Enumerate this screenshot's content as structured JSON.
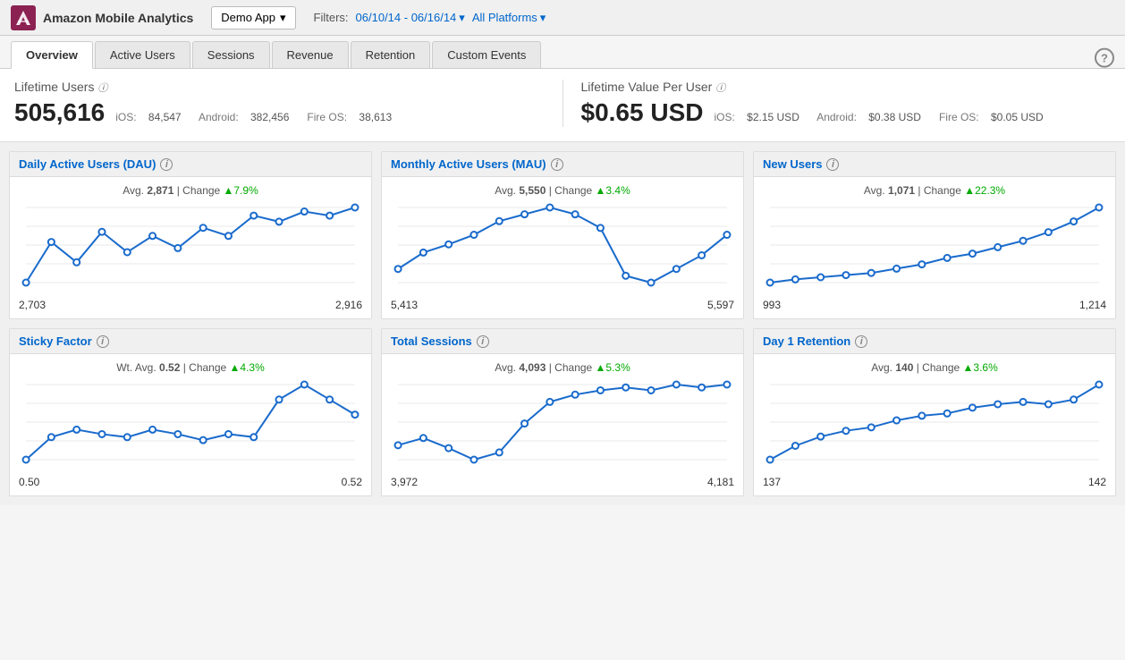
{
  "app": {
    "logo_text": "Amazon Mobile Analytics",
    "demo_app": "Demo App",
    "filters_label": "Filters:",
    "date_range": "06/10/14 - 06/16/14",
    "platforms": "All Platforms",
    "help_char": "?"
  },
  "tabs": [
    {
      "id": "overview",
      "label": "Overview",
      "active": true
    },
    {
      "id": "active-users",
      "label": "Active Users",
      "active": false
    },
    {
      "id": "sessions",
      "label": "Sessions",
      "active": false
    },
    {
      "id": "revenue",
      "label": "Revenue",
      "active": false
    },
    {
      "id": "retention",
      "label": "Retention",
      "active": false
    },
    {
      "id": "custom-events",
      "label": "Custom Events",
      "active": false
    }
  ],
  "lifetime_users": {
    "label": "Lifetime Users",
    "value": "505,616",
    "ios_label": "iOS:",
    "ios_value": "84,547",
    "android_label": "Android:",
    "android_value": "382,456",
    "fireos_label": "Fire OS:",
    "fireos_value": "38,613"
  },
  "lifetime_value": {
    "label": "Lifetime Value Per User",
    "value": "$0.65 USD",
    "ios_label": "iOS:",
    "ios_value": "$2.15 USD",
    "android_label": "Android:",
    "android_value": "$0.38 USD",
    "fireos_label": "Fire OS:",
    "fireos_value": "$0.05 USD"
  },
  "charts": [
    {
      "id": "dau",
      "title": "Daily Active Users (DAU)",
      "avg_label": "Avg.",
      "avg_value": "2,871",
      "change_label": "Change",
      "change_value": "▲7.9%",
      "start_value": "2,703",
      "end_value": "2,916",
      "points": [
        5,
        25,
        15,
        30,
        20,
        28,
        22,
        32,
        28,
        38,
        35,
        40,
        38,
        42
      ]
    },
    {
      "id": "mau",
      "title": "Monthly Active Users (MAU)",
      "avg_label": "Avg.",
      "avg_value": "5,550",
      "change_label": "Change",
      "change_value": "▲3.4%",
      "start_value": "5,413",
      "end_value": "5,597",
      "points": [
        30,
        42,
        48,
        55,
        65,
        70,
        75,
        70,
        60,
        25,
        20,
        30,
        40,
        55
      ]
    },
    {
      "id": "new-users",
      "title": "New Users",
      "avg_label": "Avg.",
      "avg_value": "1,071",
      "change_label": "Change",
      "change_value": "▲22.3%",
      "start_value": "993",
      "end_value": "1,214",
      "points": [
        5,
        8,
        10,
        12,
        14,
        18,
        22,
        28,
        32,
        38,
        44,
        52,
        62,
        75
      ]
    },
    {
      "id": "sticky-factor",
      "title": "Sticky Factor",
      "avg_label": "Wt. Avg.",
      "avg_value": "0.52",
      "change_label": "Change",
      "change_value": "▲4.3%",
      "start_value": "0.50",
      "end_value": "0.52",
      "points": [
        5,
        20,
        25,
        22,
        20,
        25,
        22,
        18,
        22,
        20,
        45,
        55,
        45,
        35
      ]
    },
    {
      "id": "total-sessions",
      "title": "Total Sessions",
      "avg_label": "Avg.",
      "avg_value": "4,093",
      "change_label": "Change",
      "change_value": "▲5.3%",
      "start_value": "3,972",
      "end_value": "4,181",
      "points": [
        30,
        35,
        28,
        20,
        25,
        45,
        60,
        65,
        68,
        70,
        68,
        72,
        70,
        72
      ]
    },
    {
      "id": "day1-retention",
      "title": "Day 1 Retention",
      "avg_label": "Avg.",
      "avg_value": "140",
      "change_label": "Change",
      "change_value": "▲3.6%",
      "start_value": "137",
      "end_value": "142",
      "points": [
        10,
        22,
        30,
        35,
        38,
        44,
        48,
        50,
        55,
        58,
        60,
        58,
        62,
        75
      ]
    }
  ]
}
